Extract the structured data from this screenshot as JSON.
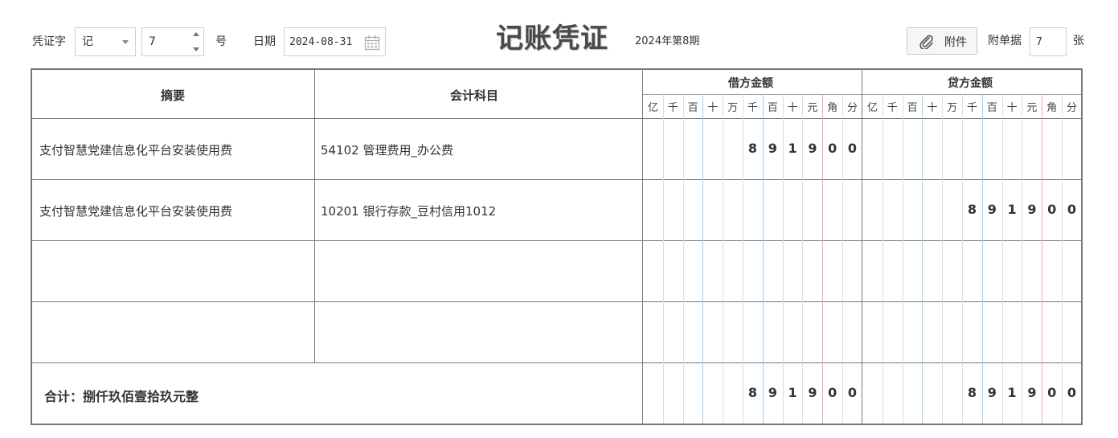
{
  "header": {
    "voucher_word_label": "凭证字",
    "voucher_word_value": "记",
    "voucher_no_value": "7",
    "no_suffix": "号",
    "date_label": "日期",
    "date_value": "2024-08-31",
    "title": "记账凭证",
    "period": "2024年第8期",
    "attach_button": "附件",
    "attach_count_label": "附单据",
    "attach_count_value": "7",
    "attach_count_suffix": "张"
  },
  "table": {
    "col_summary": "摘要",
    "col_account": "会计科目",
    "col_debit": "借方金额",
    "col_credit": "贷方金额",
    "units": [
      "亿",
      "千",
      "百",
      "十",
      "万",
      "千",
      "百",
      "十",
      "元",
      "角",
      "分"
    ],
    "rows": [
      {
        "summary": "支付智慧党建信息化平台安装使用费",
        "account": "54102 管理费用_办公费",
        "debit": [
          "",
          "",
          "",
          "",
          "",
          "8",
          "9",
          "1",
          "9",
          "0",
          "0"
        ],
        "credit": [
          "",
          "",
          "",
          "",
          "",
          "",
          "",
          "",
          "",
          "",
          ""
        ]
      },
      {
        "summary": "支付智慧党建信息化平台安装使用费",
        "account": "10201 银行存款_豆村信用1012",
        "debit": [
          "",
          "",
          "",
          "",
          "",
          "",
          "",
          "",
          "",
          "",
          ""
        ],
        "credit": [
          "",
          "",
          "",
          "",
          "",
          "8",
          "9",
          "1",
          "9",
          "0",
          "0"
        ]
      },
      {
        "summary": "",
        "account": "",
        "debit": [
          "",
          "",
          "",
          "",
          "",
          "",
          "",
          "",
          "",
          "",
          ""
        ],
        "credit": [
          "",
          "",
          "",
          "",
          "",
          "",
          "",
          "",
          "",
          "",
          ""
        ]
      },
      {
        "summary": "",
        "account": "",
        "debit": [
          "",
          "",
          "",
          "",
          "",
          "",
          "",
          "",
          "",
          "",
          ""
        ],
        "credit": [
          "",
          "",
          "",
          "",
          "",
          "",
          "",
          "",
          "",
          "",
          ""
        ]
      }
    ],
    "total_label": "合计：捌仟玖佰壹拾玖元整",
    "total_debit": [
      "",
      "",
      "",
      "",
      "",
      "8",
      "9",
      "1",
      "9",
      "0",
      "0"
    ],
    "total_credit": [
      "",
      "",
      "",
      "",
      "",
      "8",
      "9",
      "1",
      "9",
      "0",
      "0"
    ]
  }
}
